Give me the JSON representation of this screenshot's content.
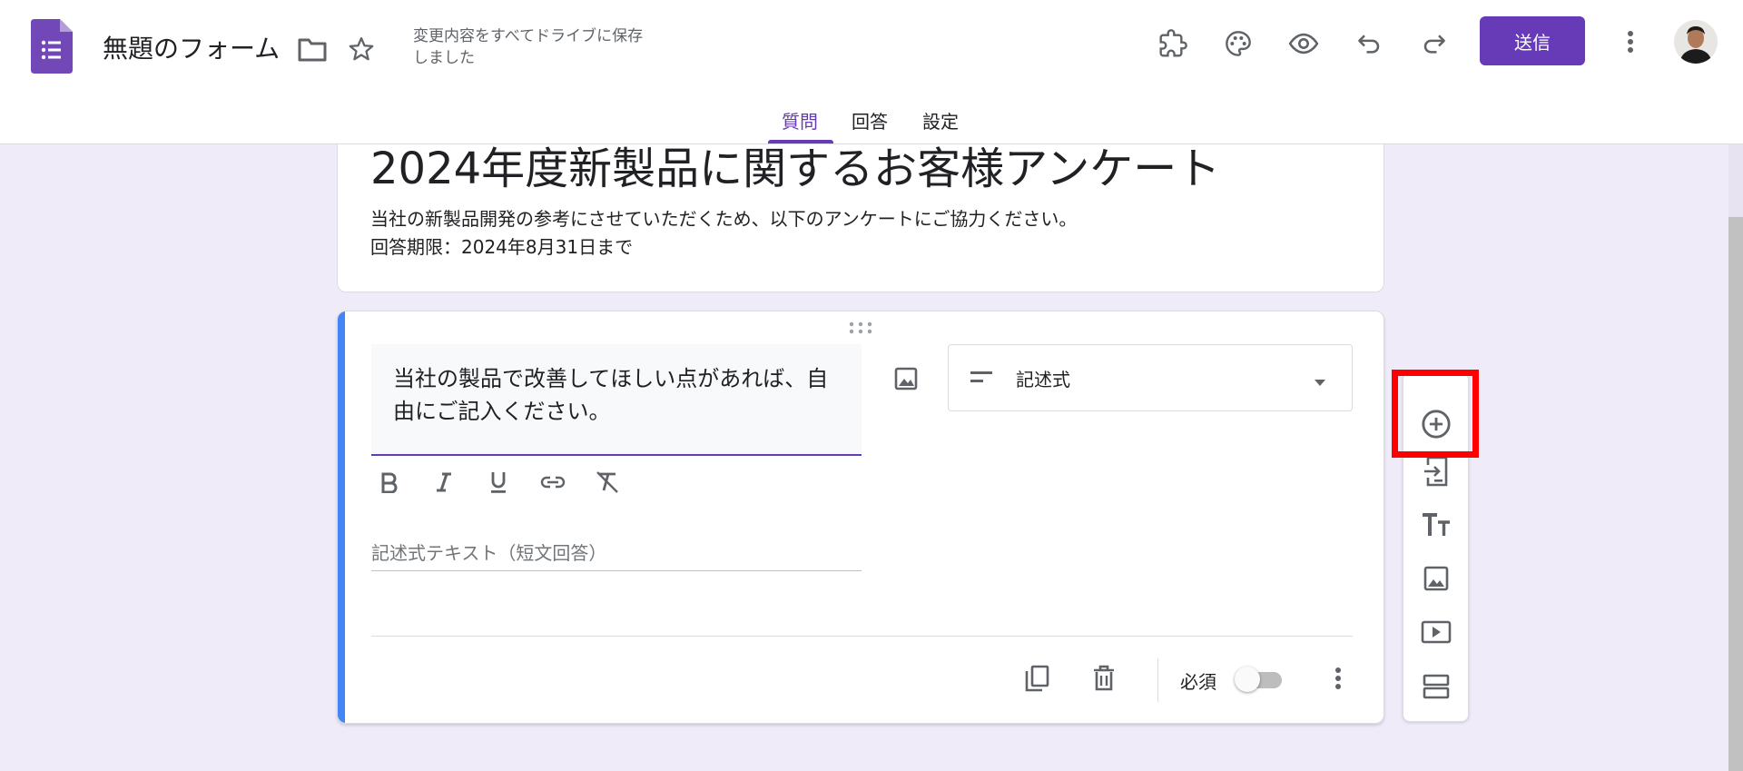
{
  "header": {
    "doc_title": "無題のフォーム",
    "save_status": "変更内容をすべてドライブに保存しました",
    "send_label": "送信"
  },
  "tabs": [
    {
      "label": "質問",
      "active": true
    },
    {
      "label": "回答",
      "active": false
    },
    {
      "label": "設定",
      "active": false
    }
  ],
  "form": {
    "title": "2024年度新製品に関するお客様アンケート",
    "description": "当社の新製品開発の参考にさせていただくため、以下のアンケートにご協力ください。\n回答期限：2024年8月31日まで"
  },
  "question": {
    "title": "当社の製品で改善してほしい点があれば、自由にご記入ください。",
    "type_label": "記述式",
    "answer_placeholder": "記述式テキスト（短文回答）",
    "required_label": "必須",
    "required": false
  },
  "side_toolbar": {
    "items": [
      "add-question-icon",
      "import-questions-icon",
      "add-title-icon",
      "add-image-icon",
      "add-video-icon",
      "add-section-icon"
    ],
    "highlighted": "add-question-icon"
  },
  "colors": {
    "accent": "#673ab7",
    "question_accent": "#4285f4",
    "background": "#f0ebf8",
    "highlight": "#ff0000"
  }
}
